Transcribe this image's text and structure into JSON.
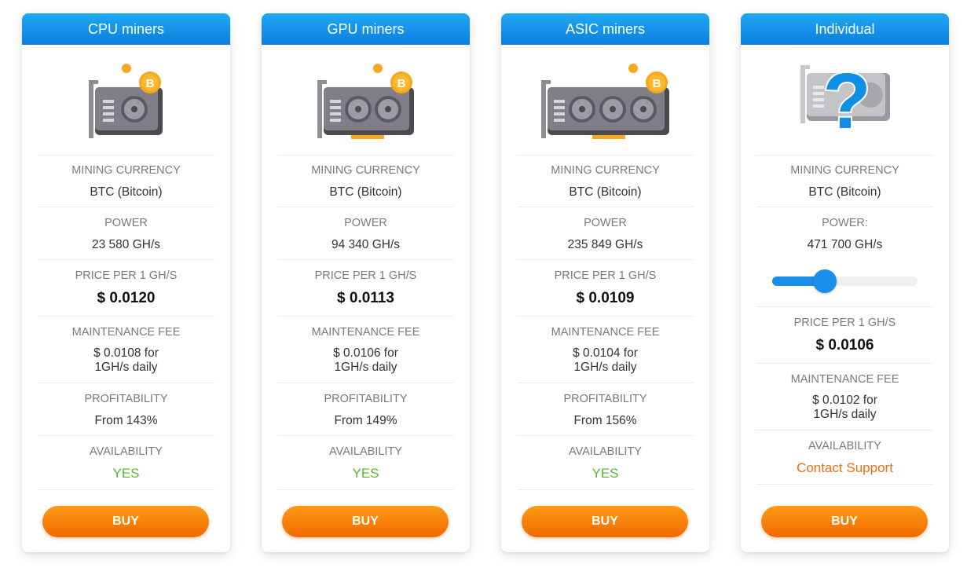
{
  "colors": {
    "header": "#0b7ee0",
    "buy": "#f06a00",
    "yes": "#5cb82f",
    "contact": "#f06f13"
  },
  "labels": {
    "currency": "MINING CURRENCY",
    "power": "POWER",
    "power_colon": "POWER:",
    "price": "PRICE PER 1 GH/S",
    "fee": "MAINTENANCE FEE",
    "profit": "PROFITABILITY",
    "avail": "AVAILABILITY",
    "buy": "BUY"
  },
  "cards": [
    {
      "title": "CPU miners",
      "icon": "cpu-miner-icon",
      "currency": "BTC (Bitcoin)",
      "power": "23 580 GH/s",
      "price": "$ 0.0120",
      "fee_line1": "$ 0.0108 for",
      "fee_line2": "1GH/s daily",
      "profit": "From 143%",
      "availability": "YES"
    },
    {
      "title": "GPU miners",
      "icon": "gpu-miner-icon",
      "currency": "BTC (Bitcoin)",
      "power": "94 340 GH/s",
      "price": "$ 0.0113",
      "fee_line1": "$ 0.0106 for",
      "fee_line2": "1GH/s daily",
      "profit": "From 149%",
      "availability": "YES"
    },
    {
      "title": "ASIC miners",
      "icon": "asic-miner-icon",
      "currency": "BTC (Bitcoin)",
      "power": "235 849 GH/s",
      "price": "$ 0.0109",
      "fee_line1": "$ 0.0104 for",
      "fee_line2": "1GH/s daily",
      "profit": "From 156%",
      "availability": "YES"
    },
    {
      "title": "Individual",
      "icon": "question-miner-icon",
      "currency": "BTC (Bitcoin)",
      "power": "471 700 GH/s",
      "power_slider_fraction": 0.36,
      "price": "$ 0.0106",
      "fee_line1": "$ 0.0102 for",
      "fee_line2": "1GH/s daily",
      "availability": "Contact Support"
    }
  ]
}
